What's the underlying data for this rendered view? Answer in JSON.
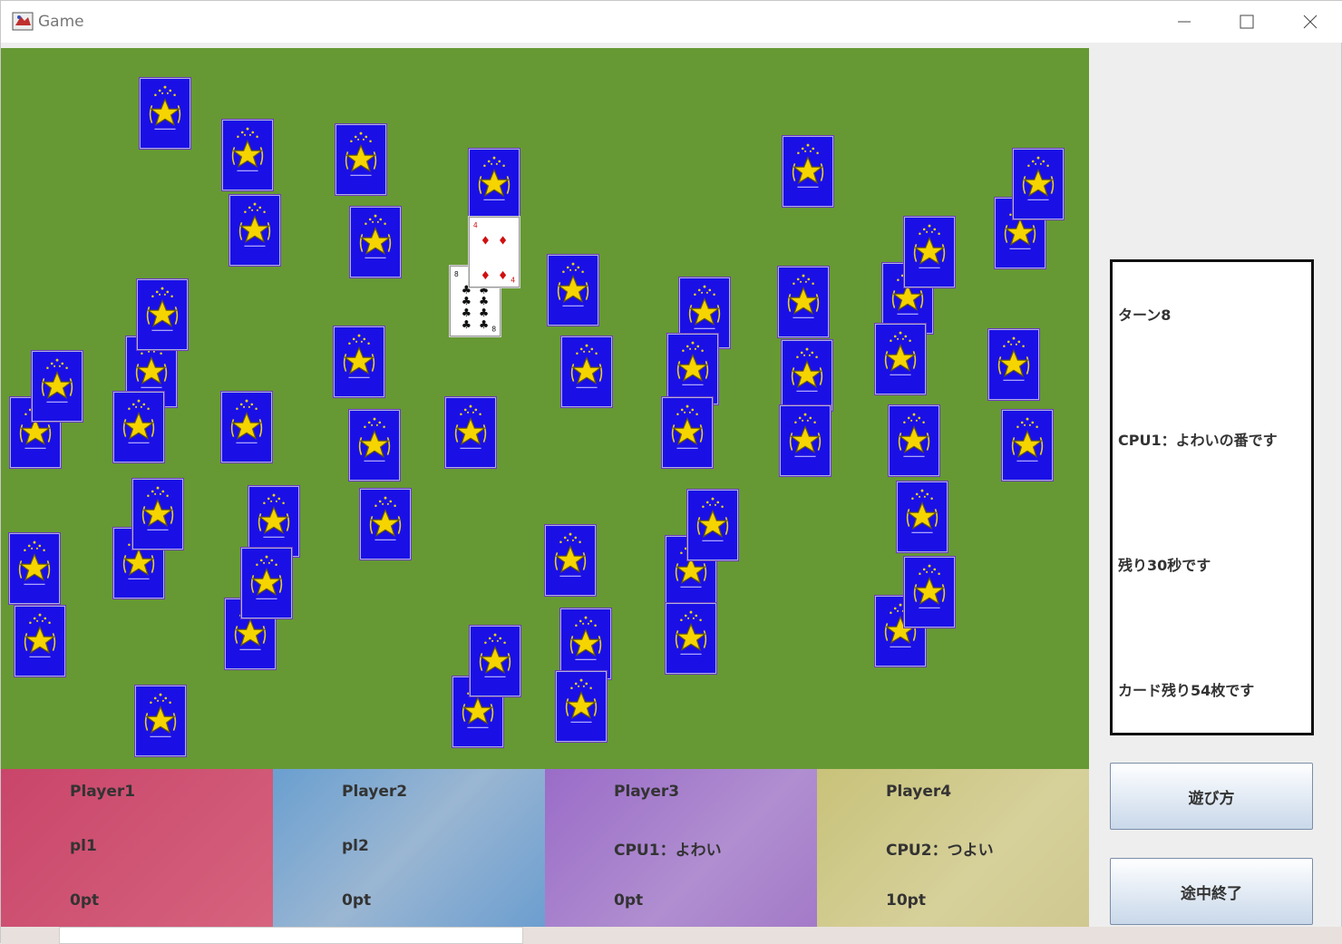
{
  "window": {
    "title": "Game"
  },
  "status": {
    "turn": "ターン8",
    "current_player": "CPU1：よわいの番です",
    "time_left": "残り30秒です",
    "cards_left": "カード残り54枚です"
  },
  "buttons": {
    "howto": "遊び方",
    "quit": "途中終了"
  },
  "players": [
    {
      "name": "Player1",
      "user": "pl1",
      "score": "0pt",
      "color": "#d6637e"
    },
    {
      "name": "Player2",
      "user": "pl2",
      "score": "0pt",
      "color": "#8fb2d4"
    },
    {
      "name": "Player3",
      "user": "CPU1：よわい",
      "score": "0pt",
      "color": "#ac84cc"
    },
    {
      "name": "Player4",
      "user": "CPU2：つよい",
      "score": "10pt",
      "color": "#d3cd95"
    }
  ],
  "board": {
    "color": "#669933",
    "card_back_color": "#1a10e6",
    "face_up_cards": [
      {
        "rank": "4",
        "suit": "diamonds"
      },
      {
        "rank": "8",
        "suit": "clubs"
      }
    ]
  }
}
